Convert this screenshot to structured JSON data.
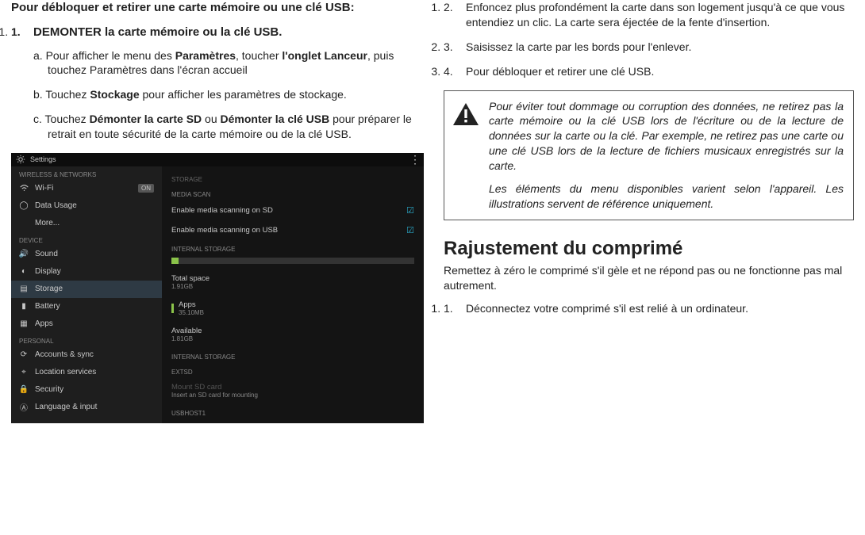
{
  "left": {
    "title": "Pour débloquer et retirer une carte mémoire ou une clé USB:",
    "step1": "DEMONTER la carte mémoire ou la clé USB.",
    "sub_a_pre": "a. Pour afficher le menu des ",
    "sub_a_b1": "Paramètres",
    "sub_a_mid": ", toucher ",
    "sub_a_b2": "l'onglet Lanceur",
    "sub_a_post": ", puis touchez Paramètres dans l'écran accueil",
    "sub_b_pre": "b. Touchez ",
    "sub_b_b": "Stockage",
    "sub_b_post": " pour afficher les paramètres de stockage.",
    "sub_c_pre": "c. Touchez ",
    "sub_c_b1": "Démonter la carte SD",
    "sub_c_mid": " ou ",
    "sub_c_b2": "Démonter la clé USB",
    "sub_c_post": " pour préparer le retrait en toute sécurité de la carte mémoire ou de la clé USB."
  },
  "shot": {
    "title": "Settings",
    "sidebar": {
      "headers": [
        "WIRELESS & NETWORKS",
        "DEVICE",
        "PERSONAL"
      ],
      "wifi": "Wi-Fi",
      "wifi_toggle": "ON",
      "data_usage": "Data Usage",
      "more": "More...",
      "sound": "Sound",
      "display": "Display",
      "storage": "Storage",
      "battery": "Battery",
      "apps": "Apps",
      "accounts": "Accounts & sync",
      "location": "Location services",
      "security": "Security",
      "language": "Language & input"
    },
    "panel": {
      "header_storage": "Storage",
      "header_media": "MEDIA SCAN",
      "scan_sd": "Enable media scanning on SD",
      "scan_usb": "Enable media scanning on USB",
      "header_internal": "INTERNAL STORAGE",
      "total_label": "Total space",
      "total_val": "1.91GB",
      "apps_label": "Apps",
      "apps_val": "35.10MB",
      "avail_label": "Available",
      "avail_val": "1.81GB",
      "header_internal2": "INTERNAL STORAGE",
      "header_extsd": "EXTSD",
      "mount_label": "Mount SD card",
      "mount_sub": "Insert an SD card for mounting",
      "header_usbhost": "USBHOST1"
    }
  },
  "right": {
    "step2": "Enfoncez plus profondément la carte dans son logement jusqu'à ce que vous entendiez un clic. La carte sera éjectée de la fente d'insertion.",
    "step3": "Saisissez la carte par les bords pour l'enlever.",
    "step4": "Pour débloquer et retirer une clé USB.",
    "warn1": "Pour éviter tout dommage ou corruption des données, ne retirez pas la carte mémoire ou la clé USB lors de l'écriture ou de la lecture de données sur la carte ou la clé. Par exemple, ne retirez pas une carte ou une clé USB lors de la lecture de fichiers musicaux enregistrés sur la carte.",
    "warn2": "Les éléments du menu disponibles varient selon l'appareil. Les illustrations servent de référence uniquement.",
    "section_title": "Rajustement du comprimé",
    "section_sub": "Remettez à zéro le comprimé s'il gèle et ne répond pas ou ne fonctionne pas mal autrement.",
    "reset1": "Déconnectez votre comprimé s'il est relié à un ordinateur."
  }
}
